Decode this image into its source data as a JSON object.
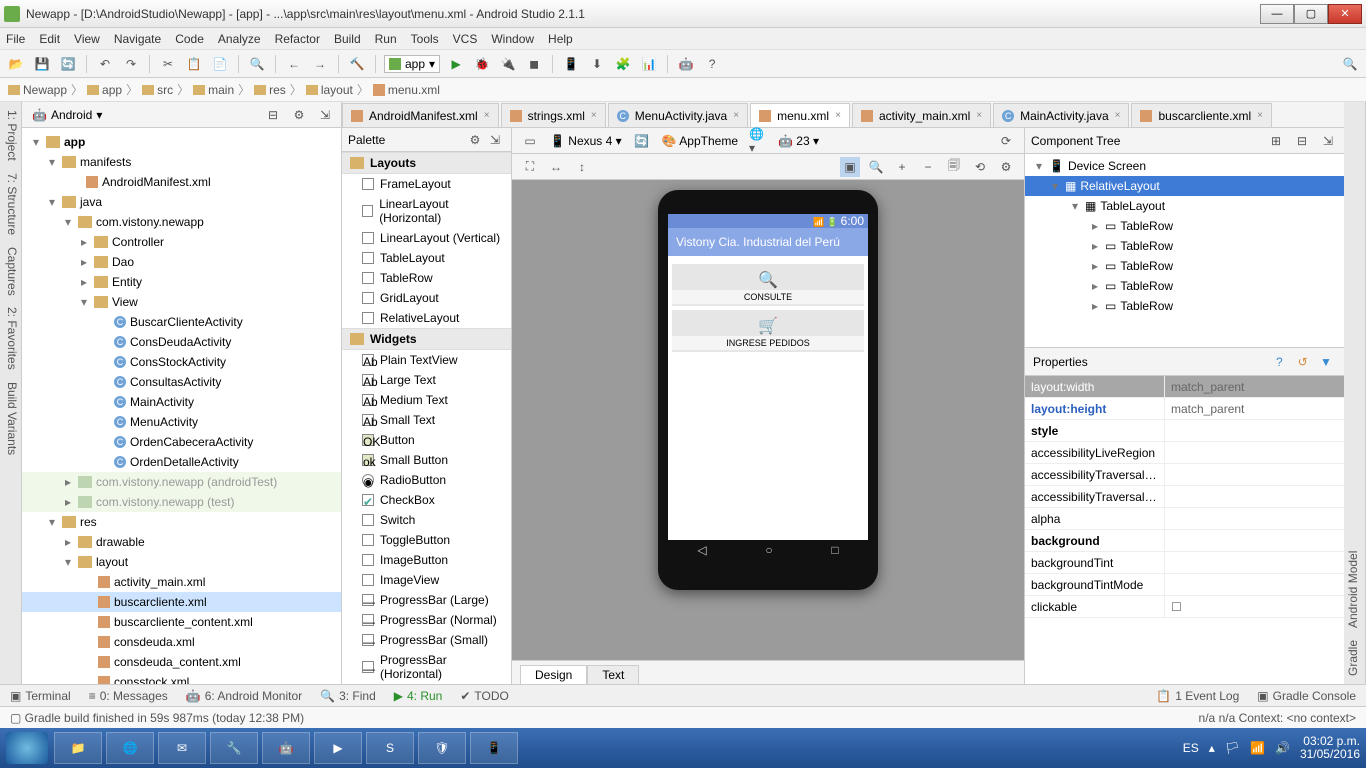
{
  "window": {
    "title": "Newapp - [D:\\AndroidStudio\\Newapp] - [app] - ...\\app\\src\\main\\res\\layout\\menu.xml - Android Studio 2.1.1"
  },
  "menubar": [
    "File",
    "Edit",
    "View",
    "Navigate",
    "Code",
    "Analyze",
    "Refactor",
    "Build",
    "Run",
    "Tools",
    "VCS",
    "Window",
    "Help"
  ],
  "breadcrumb": [
    "Newapp",
    "app",
    "src",
    "main",
    "res",
    "layout",
    "menu.xml"
  ],
  "project": {
    "viewMode": "Android",
    "tree": {
      "app": "app",
      "manifests": "manifests",
      "manifestFile": "AndroidManifest.xml",
      "java": "java",
      "pkg": "com.vistony.newapp",
      "folders": [
        "Controller",
        "Dao",
        "Entity",
        "View"
      ],
      "activities": [
        "BuscarClienteActivity",
        "ConsDeudaActivity",
        "ConsStockActivity",
        "ConsultasActivity",
        "MainActivity",
        "MenuActivity",
        "OrdenCabeceraActivity",
        "OrdenDetalleActivity"
      ],
      "pkgTest": "com.vistony.newapp (androidTest)",
      "pkgUnit": "com.vistony.newapp (test)",
      "res": "res",
      "drawable": "drawable",
      "layout": "layout",
      "layouts": [
        "activity_main.xml",
        "buscarcliente.xml",
        "buscarcliente_content.xml",
        "consdeuda.xml",
        "consdeuda_content.xml",
        "consstock.xml"
      ]
    }
  },
  "tabs": [
    {
      "label": "AndroidManifest.xml",
      "icon": "x"
    },
    {
      "label": "strings.xml",
      "icon": "x"
    },
    {
      "label": "MenuActivity.java",
      "icon": "j"
    },
    {
      "label": "menu.xml",
      "icon": "x",
      "active": true
    },
    {
      "label": "activity_main.xml",
      "icon": "x"
    },
    {
      "label": "MainActivity.java",
      "icon": "j"
    },
    {
      "label": "buscarcliente.xml",
      "icon": "x"
    }
  ],
  "palette": {
    "title": "Palette",
    "groups": [
      {
        "name": "Layouts",
        "items": [
          "FrameLayout",
          "LinearLayout (Horizontal)",
          "LinearLayout (Vertical)",
          "TableLayout",
          "TableRow",
          "GridLayout",
          "RelativeLayout"
        ]
      },
      {
        "name": "Widgets",
        "items": [
          "Plain TextView",
          "Large Text",
          "Medium Text",
          "Small Text",
          "Button",
          "Small Button",
          "RadioButton",
          "CheckBox",
          "Switch",
          "ToggleButton",
          "ImageButton",
          "ImageView",
          "ProgressBar (Large)",
          "ProgressBar (Normal)",
          "ProgressBar (Small)",
          "ProgressBar (Horizontal)"
        ]
      }
    ]
  },
  "designer": {
    "device": "Nexus 4",
    "theme": "AppTheme",
    "apiLevel": "23",
    "statusTime": "6:00",
    "appTitle": "Vistony Cia. Industrial del Perú",
    "card1": "CONSULTE",
    "card2": "INGRESE PEDIDOS",
    "modeTabs": [
      "Design",
      "Text"
    ]
  },
  "componentTree": {
    "title": "Component Tree",
    "root": "Device Screen",
    "rel": "RelativeLayout",
    "table": "TableLayout",
    "rows": [
      "TableRow",
      "TableRow",
      "TableRow",
      "TableRow",
      "TableRow"
    ]
  },
  "properties": {
    "title": "Properties",
    "rows": [
      {
        "k": "layout:width",
        "v": "match_parent",
        "hdr": true
      },
      {
        "k": "layout:height",
        "v": "match_parent",
        "bold": true
      },
      {
        "k": "style",
        "v": ""
      },
      {
        "k": "accessibilityLiveRegion",
        "v": ""
      },
      {
        "k": "accessibilityTraversalAfter",
        "v": ""
      },
      {
        "k": "accessibilityTraversalBefore",
        "v": ""
      },
      {
        "k": "alpha",
        "v": ""
      },
      {
        "k": "background",
        "v": "",
        "boldk": true
      },
      {
        "k": "backgroundTint",
        "v": ""
      },
      {
        "k": "backgroundTintMode",
        "v": ""
      },
      {
        "k": "clickable",
        "v": "☐"
      }
    ]
  },
  "bottombar": {
    "items": [
      "Terminal",
      "0: Messages",
      "6: Android Monitor",
      "3: Find",
      "4: Run",
      "TODO"
    ],
    "right": [
      "1 Event Log",
      "Gradle Console"
    ]
  },
  "status": {
    "msg": "Gradle build finished in 59s 987ms (today 12:38 PM)",
    "right": "n/a    n/a   Context: <no context>"
  },
  "taskbar": {
    "lang": "ES",
    "time": "03:02 p.m.",
    "date": "31/05/2016"
  },
  "toolbarRun": "app"
}
